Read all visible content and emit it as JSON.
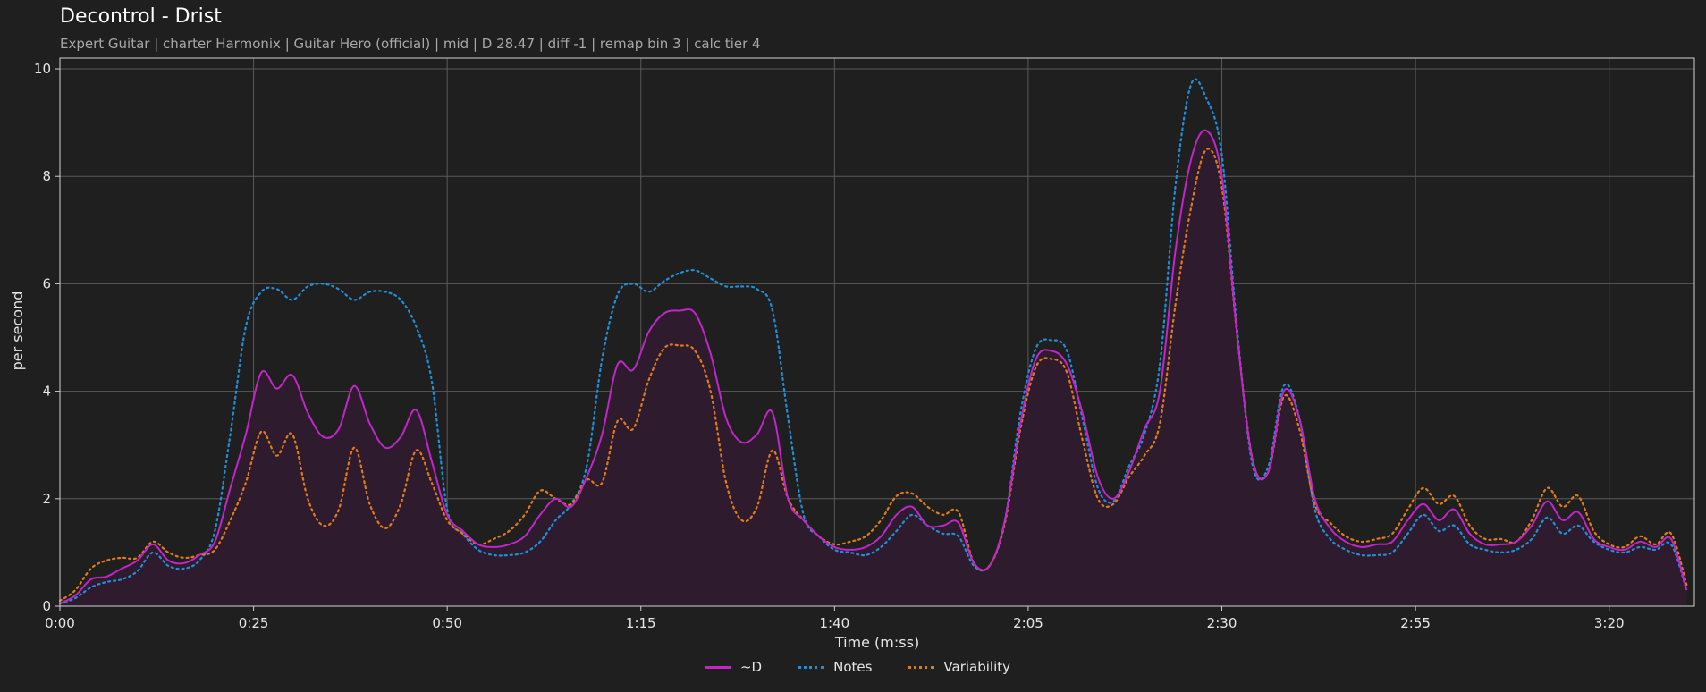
{
  "header": {
    "title": "Decontrol - Drist",
    "subtitle": "Expert Guitar  |  charter Harmonix  |  Guitar Hero (official)  |  mid  |  D 28.47  |  diff -1  |  remap bin 3  |  calc tier 4"
  },
  "chart_data": {
    "type": "line",
    "xlabel": "Time (m:ss)",
    "ylabel": "per second",
    "xlim": [
      0,
      211
    ],
    "ylim": [
      0,
      10.2
    ],
    "x_ticks": [
      0,
      25,
      50,
      75,
      100,
      125,
      150,
      175,
      200
    ],
    "x_tick_labels": [
      "0:00",
      "0:25",
      "0:50",
      "1:15",
      "1:40",
      "2:05",
      "2:30",
      "2:55",
      "3:20"
    ],
    "y_ticks": [
      0,
      2,
      4,
      6,
      8,
      10
    ],
    "y_tick_labels": [
      "0",
      "2",
      "4",
      "6",
      "8",
      "10"
    ],
    "grid": true,
    "legend_position": "bottom-center",
    "series": [
      {
        "name": "~D",
        "color": "#c026c8",
        "style": "solid",
        "fill": "#2e1c2e",
        "points": [
          [
            0,
            0.05
          ],
          [
            2,
            0.2
          ],
          [
            4,
            0.5
          ],
          [
            6,
            0.55
          ],
          [
            8,
            0.7
          ],
          [
            10,
            0.85
          ],
          [
            12,
            1.15
          ],
          [
            14,
            0.85
          ],
          [
            16,
            0.8
          ],
          [
            18,
            0.95
          ],
          [
            20,
            1.2
          ],
          [
            22,
            2.2
          ],
          [
            24,
            3.2
          ],
          [
            26,
            4.35
          ],
          [
            28,
            4.05
          ],
          [
            30,
            4.3
          ],
          [
            32,
            3.6
          ],
          [
            34,
            3.15
          ],
          [
            36,
            3.3
          ],
          [
            38,
            4.1
          ],
          [
            40,
            3.4
          ],
          [
            42,
            2.95
          ],
          [
            44,
            3.15
          ],
          [
            46,
            3.65
          ],
          [
            48,
            2.7
          ],
          [
            50,
            1.7
          ],
          [
            52,
            1.4
          ],
          [
            54,
            1.15
          ],
          [
            56,
            1.1
          ],
          [
            58,
            1.15
          ],
          [
            60,
            1.3
          ],
          [
            62,
            1.7
          ],
          [
            64,
            2.0
          ],
          [
            66,
            1.85
          ],
          [
            68,
            2.4
          ],
          [
            70,
            3.2
          ],
          [
            72,
            4.5
          ],
          [
            74,
            4.4
          ],
          [
            76,
            5.1
          ],
          [
            78,
            5.45
          ],
          [
            80,
            5.5
          ],
          [
            82,
            5.45
          ],
          [
            84,
            4.7
          ],
          [
            86,
            3.5
          ],
          [
            88,
            3.05
          ],
          [
            90,
            3.2
          ],
          [
            92,
            3.6
          ],
          [
            94,
            2.0
          ],
          [
            96,
            1.6
          ],
          [
            98,
            1.3
          ],
          [
            100,
            1.1
          ],
          [
            102,
            1.05
          ],
          [
            104,
            1.1
          ],
          [
            106,
            1.3
          ],
          [
            108,
            1.7
          ],
          [
            110,
            1.85
          ],
          [
            112,
            1.5
          ],
          [
            114,
            1.5
          ],
          [
            116,
            1.55
          ],
          [
            118,
            0.8
          ],
          [
            120,
            0.75
          ],
          [
            122,
            1.6
          ],
          [
            124,
            3.4
          ],
          [
            126,
            4.6
          ],
          [
            128,
            4.75
          ],
          [
            130,
            4.5
          ],
          [
            132,
            3.6
          ],
          [
            134,
            2.4
          ],
          [
            136,
            2.0
          ],
          [
            138,
            2.5
          ],
          [
            140,
            3.3
          ],
          [
            142,
            4.0
          ],
          [
            144,
            6.6
          ],
          [
            146,
            8.3
          ],
          [
            148,
            8.85
          ],
          [
            150,
            8.0
          ],
          [
            152,
            5.0
          ],
          [
            154,
            2.7
          ],
          [
            156,
            2.5
          ],
          [
            158,
            4.0
          ],
          [
            160,
            3.5
          ],
          [
            162,
            2.0
          ],
          [
            164,
            1.45
          ],
          [
            166,
            1.2
          ],
          [
            168,
            1.1
          ],
          [
            170,
            1.15
          ],
          [
            172,
            1.2
          ],
          [
            174,
            1.6
          ],
          [
            176,
            1.9
          ],
          [
            178,
            1.6
          ],
          [
            180,
            1.8
          ],
          [
            182,
            1.35
          ],
          [
            184,
            1.15
          ],
          [
            186,
            1.15
          ],
          [
            188,
            1.2
          ],
          [
            190,
            1.5
          ],
          [
            192,
            1.95
          ],
          [
            194,
            1.6
          ],
          [
            196,
            1.75
          ],
          [
            198,
            1.25
          ],
          [
            200,
            1.1
          ],
          [
            202,
            1.05
          ],
          [
            204,
            1.2
          ],
          [
            206,
            1.1
          ],
          [
            208,
            1.25
          ],
          [
            210,
            0.3
          ]
        ]
      },
      {
        "name": "Notes",
        "color": "#1f8fd6",
        "style": "dotted",
        "points": [
          [
            0,
            0.05
          ],
          [
            2,
            0.15
          ],
          [
            4,
            0.35
          ],
          [
            6,
            0.45
          ],
          [
            8,
            0.5
          ],
          [
            10,
            0.65
          ],
          [
            12,
            1.0
          ],
          [
            14,
            0.75
          ],
          [
            16,
            0.7
          ],
          [
            18,
            0.85
          ],
          [
            20,
            1.4
          ],
          [
            22,
            3.2
          ],
          [
            24,
            5.2
          ],
          [
            26,
            5.85
          ],
          [
            28,
            5.9
          ],
          [
            30,
            5.7
          ],
          [
            32,
            5.95
          ],
          [
            34,
            6.0
          ],
          [
            36,
            5.9
          ],
          [
            38,
            5.7
          ],
          [
            40,
            5.85
          ],
          [
            42,
            5.85
          ],
          [
            44,
            5.7
          ],
          [
            46,
            5.2
          ],
          [
            48,
            4.2
          ],
          [
            50,
            1.8
          ],
          [
            52,
            1.35
          ],
          [
            54,
            1.05
          ],
          [
            56,
            0.95
          ],
          [
            58,
            0.95
          ],
          [
            60,
            1.0
          ],
          [
            62,
            1.2
          ],
          [
            64,
            1.6
          ],
          [
            66,
            1.9
          ],
          [
            68,
            2.6
          ],
          [
            70,
            4.6
          ],
          [
            72,
            5.8
          ],
          [
            74,
            6.0
          ],
          [
            76,
            5.85
          ],
          [
            78,
            6.05
          ],
          [
            80,
            6.2
          ],
          [
            82,
            6.25
          ],
          [
            84,
            6.1
          ],
          [
            86,
            5.95
          ],
          [
            88,
            5.95
          ],
          [
            90,
            5.9
          ],
          [
            92,
            5.5
          ],
          [
            94,
            3.5
          ],
          [
            96,
            1.7
          ],
          [
            98,
            1.3
          ],
          [
            100,
            1.05
          ],
          [
            102,
            1.0
          ],
          [
            104,
            0.95
          ],
          [
            106,
            1.1
          ],
          [
            108,
            1.4
          ],
          [
            110,
            1.7
          ],
          [
            112,
            1.5
          ],
          [
            114,
            1.35
          ],
          [
            116,
            1.3
          ],
          [
            118,
            0.75
          ],
          [
            120,
            0.75
          ],
          [
            122,
            1.6
          ],
          [
            124,
            3.6
          ],
          [
            126,
            4.8
          ],
          [
            128,
            4.95
          ],
          [
            130,
            4.75
          ],
          [
            132,
            3.5
          ],
          [
            134,
            2.2
          ],
          [
            136,
            1.95
          ],
          [
            138,
            2.6
          ],
          [
            140,
            3.2
          ],
          [
            142,
            4.5
          ],
          [
            144,
            7.8
          ],
          [
            146,
            9.7
          ],
          [
            148,
            9.45
          ],
          [
            150,
            8.4
          ],
          [
            152,
            5.1
          ],
          [
            154,
            2.6
          ],
          [
            156,
            2.6
          ],
          [
            158,
            4.1
          ],
          [
            160,
            3.5
          ],
          [
            162,
            1.8
          ],
          [
            164,
            1.25
          ],
          [
            166,
            1.05
          ],
          [
            168,
            0.95
          ],
          [
            170,
            0.95
          ],
          [
            172,
            1.0
          ],
          [
            174,
            1.35
          ],
          [
            176,
            1.7
          ],
          [
            178,
            1.4
          ],
          [
            180,
            1.5
          ],
          [
            182,
            1.15
          ],
          [
            184,
            1.05
          ],
          [
            186,
            1.0
          ],
          [
            188,
            1.05
          ],
          [
            190,
            1.25
          ],
          [
            192,
            1.65
          ],
          [
            194,
            1.35
          ],
          [
            196,
            1.5
          ],
          [
            198,
            1.2
          ],
          [
            200,
            1.05
          ],
          [
            202,
            1.0
          ],
          [
            204,
            1.1
          ],
          [
            206,
            1.05
          ],
          [
            208,
            1.15
          ],
          [
            210,
            0.3
          ]
        ]
      },
      {
        "name": "Variability",
        "color": "#e07b1a",
        "style": "dotted",
        "points": [
          [
            0,
            0.1
          ],
          [
            2,
            0.3
          ],
          [
            4,
            0.7
          ],
          [
            6,
            0.85
          ],
          [
            8,
            0.9
          ],
          [
            10,
            0.9
          ],
          [
            12,
            1.2
          ],
          [
            14,
            1.0
          ],
          [
            16,
            0.9
          ],
          [
            18,
            0.95
          ],
          [
            20,
            1.05
          ],
          [
            22,
            1.6
          ],
          [
            24,
            2.3
          ],
          [
            26,
            3.25
          ],
          [
            28,
            2.8
          ],
          [
            30,
            3.2
          ],
          [
            32,
            2.0
          ],
          [
            34,
            1.5
          ],
          [
            36,
            1.8
          ],
          [
            38,
            2.95
          ],
          [
            40,
            1.9
          ],
          [
            42,
            1.45
          ],
          [
            44,
            1.9
          ],
          [
            46,
            2.9
          ],
          [
            48,
            2.3
          ],
          [
            50,
            1.6
          ],
          [
            52,
            1.35
          ],
          [
            54,
            1.15
          ],
          [
            56,
            1.25
          ],
          [
            58,
            1.4
          ],
          [
            60,
            1.7
          ],
          [
            62,
            2.15
          ],
          [
            64,
            2.0
          ],
          [
            66,
            1.9
          ],
          [
            68,
            2.35
          ],
          [
            70,
            2.3
          ],
          [
            72,
            3.45
          ],
          [
            74,
            3.3
          ],
          [
            76,
            4.2
          ],
          [
            78,
            4.8
          ],
          [
            80,
            4.85
          ],
          [
            82,
            4.75
          ],
          [
            84,
            4.0
          ],
          [
            86,
            2.3
          ],
          [
            88,
            1.6
          ],
          [
            90,
            1.85
          ],
          [
            92,
            2.9
          ],
          [
            94,
            2.0
          ],
          [
            96,
            1.6
          ],
          [
            98,
            1.3
          ],
          [
            100,
            1.15
          ],
          [
            102,
            1.2
          ],
          [
            104,
            1.3
          ],
          [
            106,
            1.6
          ],
          [
            108,
            2.05
          ],
          [
            110,
            2.1
          ],
          [
            112,
            1.85
          ],
          [
            114,
            1.7
          ],
          [
            116,
            1.75
          ],
          [
            118,
            0.8
          ],
          [
            120,
            0.75
          ],
          [
            122,
            1.55
          ],
          [
            124,
            3.3
          ],
          [
            126,
            4.45
          ],
          [
            128,
            4.6
          ],
          [
            130,
            4.35
          ],
          [
            132,
            3.1
          ],
          [
            134,
            2.0
          ],
          [
            136,
            1.9
          ],
          [
            138,
            2.4
          ],
          [
            140,
            2.8
          ],
          [
            142,
            3.4
          ],
          [
            144,
            5.6
          ],
          [
            146,
            7.4
          ],
          [
            148,
            8.5
          ],
          [
            150,
            7.8
          ],
          [
            152,
            5.0
          ],
          [
            154,
            2.7
          ],
          [
            156,
            2.5
          ],
          [
            158,
            3.9
          ],
          [
            160,
            3.3
          ],
          [
            162,
            1.9
          ],
          [
            164,
            1.55
          ],
          [
            166,
            1.3
          ],
          [
            168,
            1.2
          ],
          [
            170,
            1.25
          ],
          [
            172,
            1.35
          ],
          [
            174,
            1.8
          ],
          [
            176,
            2.2
          ],
          [
            178,
            1.9
          ],
          [
            180,
            2.05
          ],
          [
            182,
            1.5
          ],
          [
            184,
            1.25
          ],
          [
            186,
            1.25
          ],
          [
            188,
            1.2
          ],
          [
            190,
            1.6
          ],
          [
            192,
            2.2
          ],
          [
            194,
            1.85
          ],
          [
            196,
            2.05
          ],
          [
            198,
            1.4
          ],
          [
            200,
            1.15
          ],
          [
            202,
            1.1
          ],
          [
            204,
            1.3
          ],
          [
            206,
            1.15
          ],
          [
            208,
            1.35
          ],
          [
            210,
            0.4
          ]
        ]
      }
    ]
  }
}
